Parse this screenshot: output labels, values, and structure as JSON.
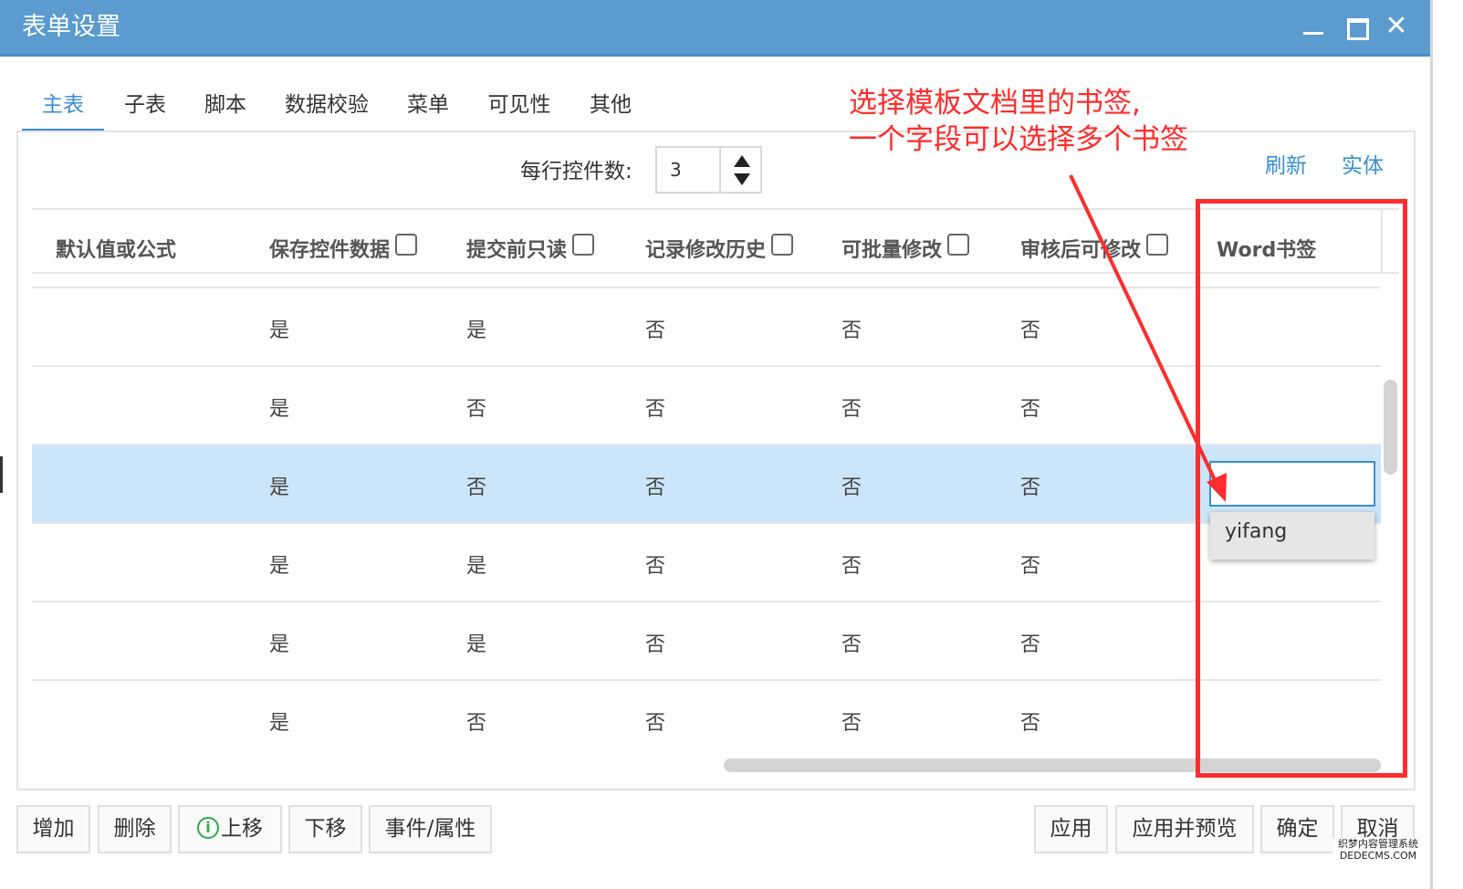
{
  "window": {
    "title": "表单设置"
  },
  "tabs": [
    {
      "label": "主表",
      "active": true
    },
    {
      "label": "子表"
    },
    {
      "label": "脚本"
    },
    {
      "label": "数据校验"
    },
    {
      "label": "菜单"
    },
    {
      "label": "可见性"
    },
    {
      "label": "其他"
    }
  ],
  "toolbar": {
    "controls_per_row_label": "每行控件数:",
    "controls_per_row_value": "3",
    "refresh_label": "刷新",
    "entity_label": "实体"
  },
  "annotation": {
    "line1": "选择模板文档里的书签,",
    "line2": "一个字段可以选择多个书签",
    "color": "#ff2d2d"
  },
  "table": {
    "headers": [
      "默认值或公式",
      "保存控件数据",
      "提交前只读",
      "记录修改历史",
      "可批量修改",
      "审核后可修改",
      "Word书签"
    ],
    "rows": [
      [
        "",
        "是",
        "是",
        "否",
        "否",
        "否",
        ""
      ],
      [
        "",
        "是",
        "否",
        "否",
        "否",
        "否",
        ""
      ],
      [
        "",
        "是",
        "否",
        "否",
        "否",
        "否",
        ""
      ],
      [
        "",
        "是",
        "是",
        "否",
        "否",
        "否",
        ""
      ],
      [
        "",
        "是",
        "是",
        "否",
        "否",
        "否",
        ""
      ],
      [
        "",
        "是",
        "否",
        "否",
        "否",
        "否",
        ""
      ]
    ],
    "selected_row": 2
  },
  "bookmark_dropdown": {
    "value": "",
    "options": [
      "yifang"
    ]
  },
  "buttons_left": [
    {
      "label": "增加"
    },
    {
      "label": "删除"
    },
    {
      "label": "上移",
      "icon": "info-icon"
    },
    {
      "label": "下移"
    },
    {
      "label": "事件/属性"
    }
  ],
  "buttons_right": [
    {
      "label": "应用"
    },
    {
      "label": "应用并预览"
    },
    {
      "label": "确定"
    },
    {
      "label": "取消"
    }
  ],
  "watermark": {
    "line1": "织梦内容管理系统",
    "line2": "DEDECMS.COM"
  },
  "colors": {
    "titlebar": "#5b9bd0",
    "accent": "#3b8ed0",
    "selected_row": "#cce5f9"
  }
}
